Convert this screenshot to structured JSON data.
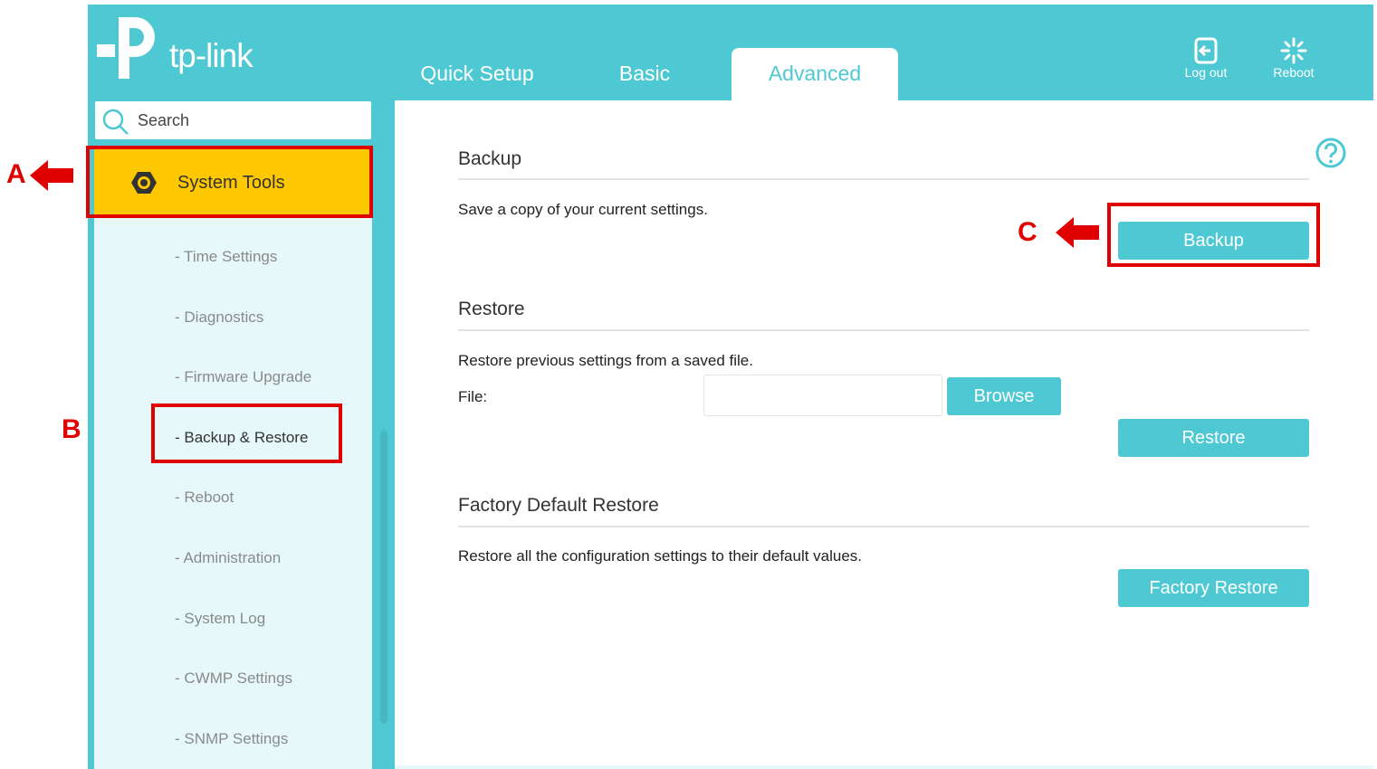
{
  "brand": {
    "name": "tp-link"
  },
  "tabs": [
    {
      "label": "Quick Setup",
      "active": false
    },
    {
      "label": "Basic",
      "active": false
    },
    {
      "label": "Advanced",
      "active": true
    }
  ],
  "header_actions": {
    "logout": "Log out",
    "reboot": "Reboot"
  },
  "search": {
    "placeholder": "Search"
  },
  "sidebar": {
    "section": {
      "label": "System Tools",
      "icon": "gear-icon",
      "active": true
    },
    "items": [
      {
        "label": "- Time Settings"
      },
      {
        "label": "- Diagnostics"
      },
      {
        "label": "- Firmware Upgrade"
      },
      {
        "label": "- Backup & Restore",
        "active": true
      },
      {
        "label": "- Reboot"
      },
      {
        "label": "- Administration"
      },
      {
        "label": "- System Log"
      },
      {
        "label": "- CWMP Settings"
      },
      {
        "label": "- SNMP Settings"
      }
    ]
  },
  "backup": {
    "title": "Backup",
    "description": "Save a copy of your current settings.",
    "button": "Backup"
  },
  "restore": {
    "title": "Restore",
    "description": "Restore previous settings from a saved file.",
    "file_label": "File:",
    "file_value": "",
    "browse_button": "Browse",
    "button": "Restore"
  },
  "factory": {
    "title": "Factory Default Restore",
    "description": "Restore all the configuration settings to their default values.",
    "button": "Factory Restore"
  },
  "annotations": {
    "a": "A",
    "b": "B",
    "c": "C",
    "color": "#e00000"
  },
  "colors": {
    "accent": "#4ec9d4",
    "highlight": "#fdc800",
    "sidebar_bg": "#e6f8f9"
  }
}
